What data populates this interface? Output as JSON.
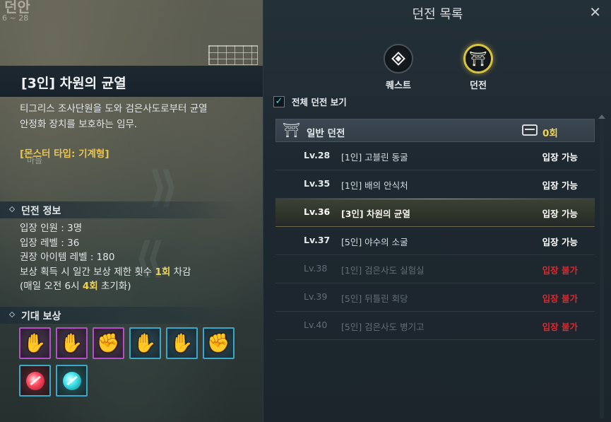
{
  "map": {
    "title": "던안",
    "coords": "6 ~ 28",
    "label": "마을"
  },
  "info": {
    "title": "[3인] 차원의 균열",
    "description_line1": "티그리스 조사단원을 도와 검은사도로부터 균열",
    "description_line2": "안정화 장치를 보호하는 임무.",
    "monster_type": "[몬스터 타입: 기계형]"
  },
  "dungeon_info": {
    "header": "던전 정보",
    "party": "입장 인원 : 3명",
    "entry_level": "입장 레벨 : 36",
    "item_level": "권장 아이템 레벨 : 180",
    "limit_prefix": "보상 획득 시 일간 보상 제한 횟수 ",
    "limit_count": "1회",
    "limit_suffix": " 차감",
    "reset_prefix": "(매일 오전 6시 ",
    "reset_count": "4회",
    "reset_suffix": " 초기화)"
  },
  "rewards": {
    "header": "기대 보상",
    "items": [
      {
        "icon": "gauntlet-icon",
        "grade": "purple"
      },
      {
        "icon": "glove-icon",
        "grade": "purple"
      },
      {
        "icon": "studded-gauntlet-icon",
        "grade": "purple"
      },
      {
        "icon": "gauntlet-icon",
        "grade": "blue"
      },
      {
        "icon": "glove-icon",
        "grade": "blue"
      },
      {
        "icon": "studded-gauntlet-icon",
        "grade": "blue"
      },
      {
        "icon": "red-gem-icon",
        "grade": "blue"
      },
      {
        "icon": "teal-gem-icon",
        "grade": "blue"
      }
    ]
  },
  "panel": {
    "title": "던전 목록",
    "close_icon": "close-icon",
    "categories": [
      {
        "label": "퀘스트",
        "icon": "quest-diamond-icon",
        "active": false
      },
      {
        "label": "던전",
        "icon": "dungeon-gate-icon",
        "active": true
      }
    ],
    "show_all_label": "전체 던전 보기",
    "show_all_checked": true,
    "group": {
      "label": "일반 던전",
      "count": "0회"
    },
    "dungeons": [
      {
        "level": "Lv.28",
        "name": "[1인] 고블린 동굴",
        "status": "입장 가능",
        "available": true,
        "selected": false
      },
      {
        "level": "Lv.35",
        "name": "[1인] 배의 안식처",
        "status": "입장 가능",
        "available": true,
        "selected": false
      },
      {
        "level": "Lv.36",
        "name": "[3인] 차원의 균열",
        "status": "입장 가능",
        "available": true,
        "selected": true
      },
      {
        "level": "Lv.37",
        "name": "[5인] 야수의 소굴",
        "status": "입장 가능",
        "available": true,
        "selected": false
      },
      {
        "level": "Lv.38",
        "name": "[1인] 검은사도 실험실",
        "status": "입장 불가",
        "available": false,
        "selected": false
      },
      {
        "level": "Lv.39",
        "name": "[5인] 뒤틀린 회당",
        "status": "입장 불가",
        "available": false,
        "selected": false
      },
      {
        "level": "Lv.40",
        "name": "[5인] 검은사도 병기고",
        "status": "입장 불가",
        "available": false,
        "selected": false
      }
    ]
  },
  "colors": {
    "highlight_yellow": "#f0d250",
    "unavailable_red": "#e0262b",
    "active_ring": "#d8c440",
    "check_cyan": "#4fd3e6"
  }
}
